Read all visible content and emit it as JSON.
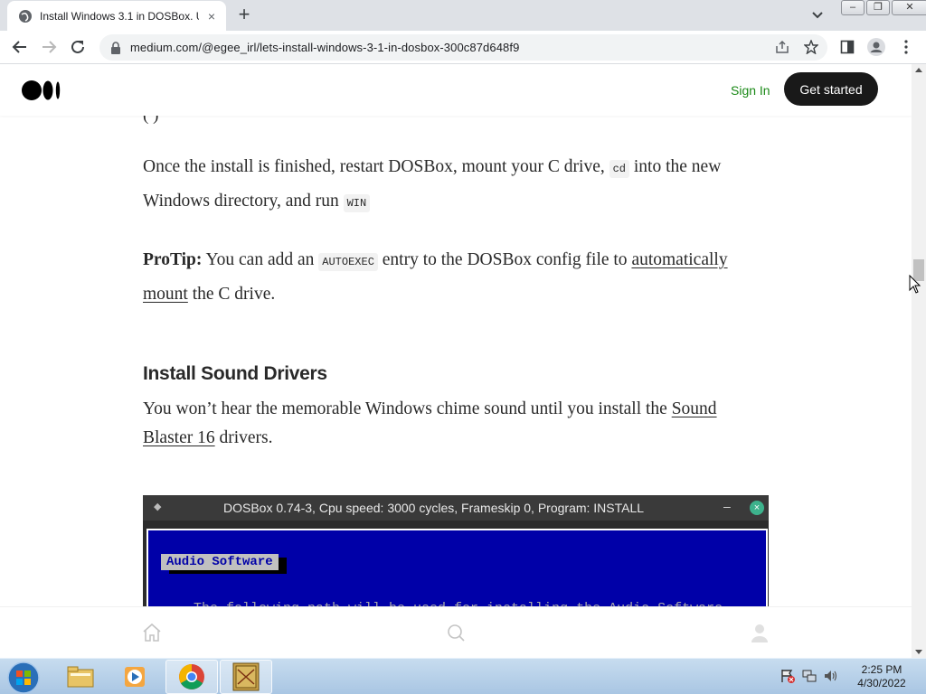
{
  "browser": {
    "tab_title": "Install Windows 3.1 in DOSBox. U",
    "tab_close": "×",
    "new_tab": "+",
    "url": "medium.com/@egee_irl/lets-install-windows-3-1-in-dosbox-300c87d648f9"
  },
  "header": {
    "sign_in": "Sign In",
    "get_started": "Get started"
  },
  "article": {
    "clipped_line": "(    )",
    "p1_before_cd": "Once the install is finished, restart DOSBox, mount your C drive, ",
    "code_cd": "cd",
    "p1_after_cd": " into the new Windows directory, and run ",
    "code_win": "WIN",
    "protip_label": "ProTip:",
    "p2_before_code": " You can add an ",
    "code_autoexec": "AUTOEXEC",
    "p2_after_code": " entry to the DOSBox config file to ",
    "p2_link": "automatically mount",
    "p2_end": " the C drive.",
    "heading": "Install Sound Drivers",
    "p3_before_link": "You won’t hear the memorable Windows chime sound until you install the ",
    "p3_link": "Sound Blaster 16",
    "p3_end": " drivers."
  },
  "dosbox": {
    "title": "DOSBox 0.74-3, Cpu speed:    3000 cycles, Frameskip  0, Program:  INSTALL",
    "minimize": "–",
    "close": "×",
    "label": "Audio Software",
    "line": "The following path will be used for installing the Audio Software"
  },
  "taskbar": {
    "time": "2:25 PM",
    "date": "4/30/2022"
  },
  "colors": {
    "accent_green": "#1a8917",
    "button_dark": "#191919",
    "dos_blue": "#0000a8"
  }
}
